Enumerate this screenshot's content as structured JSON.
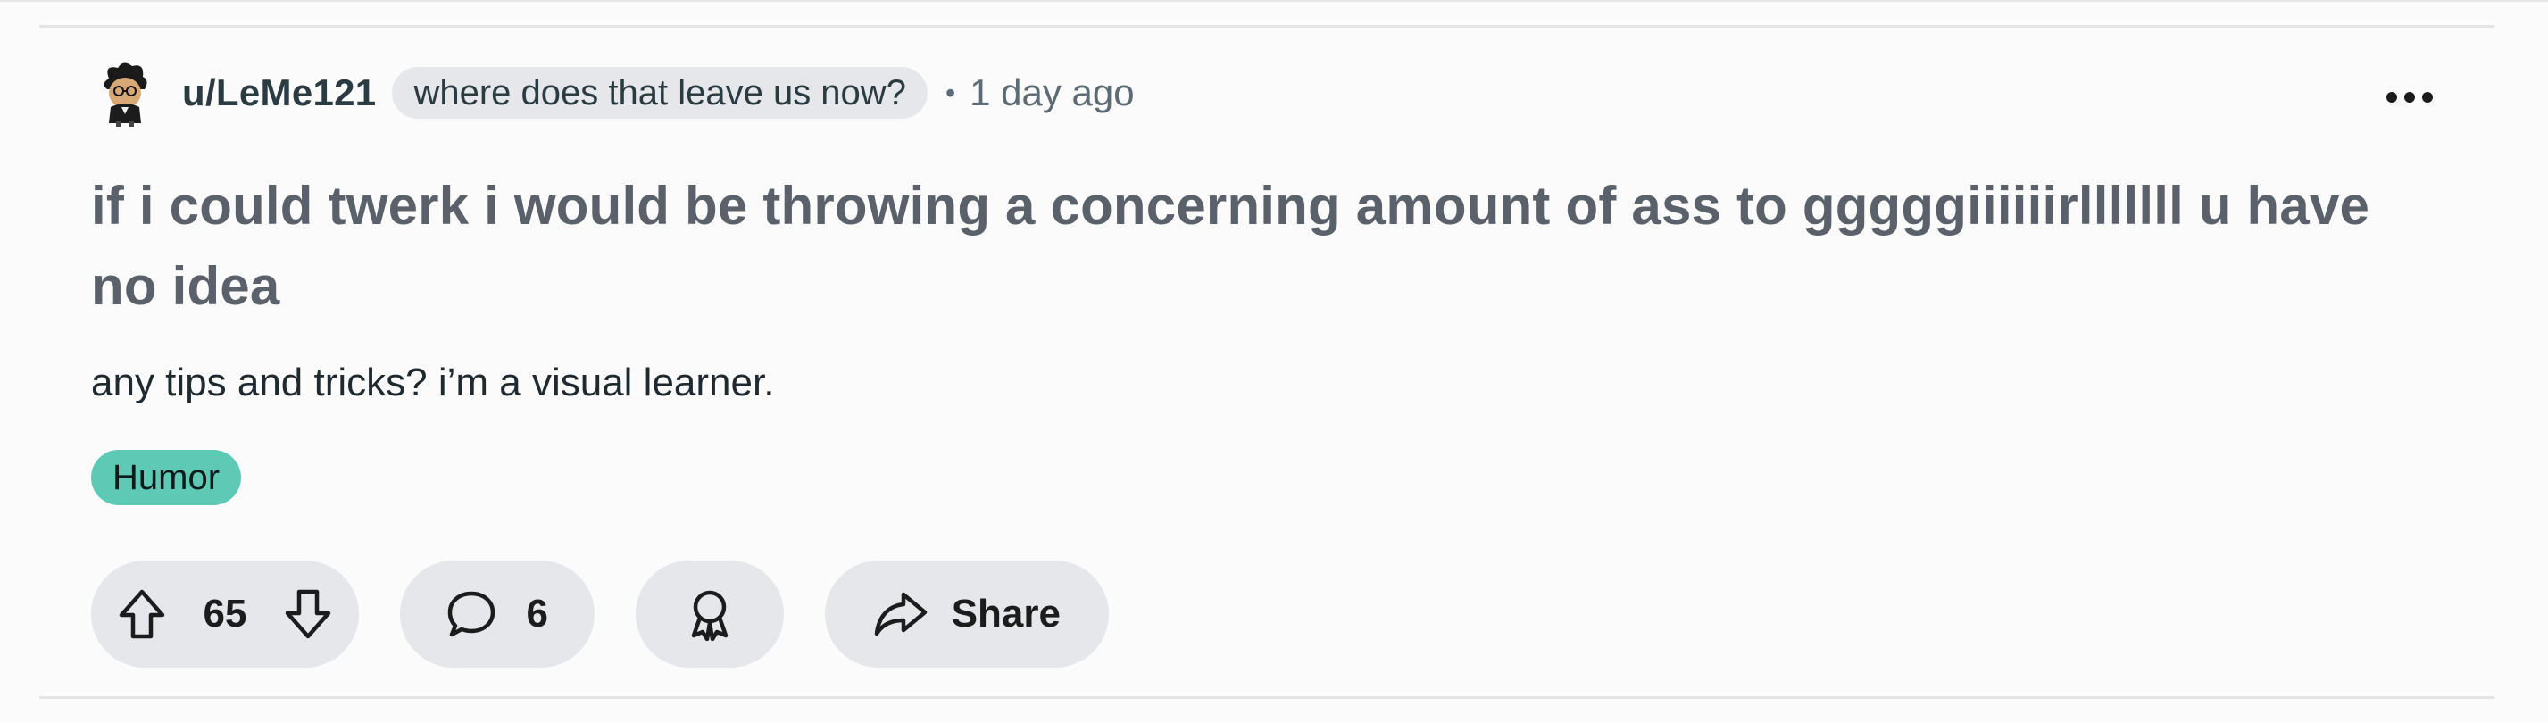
{
  "post": {
    "author": "u/LeMe121",
    "user_flair": "where does that leave us now?",
    "separator": "•",
    "time_ago": "1 day ago",
    "title": "if i could twerk i would be throwing a concerning amount of ass to gggggiiiiiirlllllll u have no idea",
    "body": "any tips and tricks? i’m a visual learner.",
    "tag": "Humor",
    "tag_color": "#5ec9b4"
  },
  "actions": {
    "vote_count": "65",
    "comment_count": "6",
    "share_label": "Share"
  },
  "icons": {
    "avatar": "user-avatar",
    "more": "more-options-icon",
    "upvote": "upvote-icon",
    "downvote": "downvote-icon",
    "comment": "comment-icon",
    "award": "award-icon",
    "share": "share-icon"
  }
}
